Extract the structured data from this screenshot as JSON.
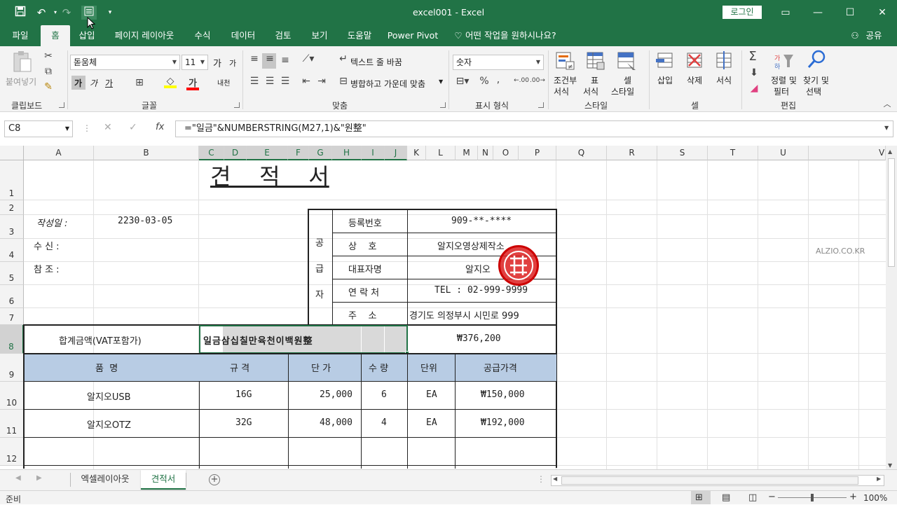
{
  "window": {
    "title": "excel001  -  Excel",
    "login_label": "로그인"
  },
  "menu": [
    "파일",
    "홈",
    "삽입",
    "페이지 레이아웃",
    "수식",
    "데이터",
    "검토",
    "보기",
    "도움말",
    "Power Pivot"
  ],
  "tellme": "어떤 작업을 원하시나요?",
  "share": "공유",
  "ribbon": {
    "clipboard": {
      "label": "클립보드",
      "paste": "붙여넣기"
    },
    "font": {
      "label": "글꼴",
      "name": "돋움체",
      "size": "11",
      "bold": "가",
      "italic": "가",
      "underline": "가",
      "grow": "가",
      "shrink": "가",
      "phonetic": "내천"
    },
    "align": {
      "label": "맞춤",
      "wrap": "텍스트 줄 바꿈",
      "merge": "병합하고 가운데 맞춤"
    },
    "number": {
      "label": "표시 형식",
      "format": "숫자"
    },
    "styles": {
      "label": "스타일",
      "cond": "조건부",
      "cond2": "서식",
      "table": "표",
      "table2": "서식",
      "cell": "셀",
      "cell2": "스타일"
    },
    "cells": {
      "label": "셀",
      "insert": "삽입",
      "delete": "삭제",
      "format": "서식"
    },
    "edit": {
      "label": "편집",
      "sort": "정렬 및",
      "sort2": "필터",
      "find": "찾기 및",
      "find2": "선택"
    }
  },
  "namebox": "C8",
  "formula": "=\"일금\"&NUMBERSTRING(M27,1)&\"원整\"",
  "columns": [
    "A",
    "B",
    "C",
    "D",
    "E",
    "F",
    "G",
    "H",
    "I",
    "J",
    "K",
    "L",
    "M",
    "N",
    "O",
    "P",
    "Q",
    "R",
    "S",
    "T",
    "U",
    "V"
  ],
  "rows": [
    "1",
    "2",
    "3",
    "4",
    "5",
    "6",
    "7",
    "8",
    "9",
    "10",
    "11",
    "12"
  ],
  "sheet": {
    "title": "견    적    서",
    "date_label": "작성일  :",
    "date_value": "2230-03-05",
    "to_label": "수  신  :",
    "ref_label": "참  조  :",
    "supplier": [
      "공",
      "급",
      "자"
    ],
    "info_labels": [
      "등록번호",
      "상    호",
      "대표자명",
      "연 락 처",
      "주    소"
    ],
    "info_values": [
      "909-**-****",
      "알지오영상제작소",
      "알지오",
      "TEL : 02-999-9999",
      "경기도 의정부시 시민로 999"
    ],
    "total_label": "합계금액(VAT포함가)",
    "total_korean": "일금삼십칠만육천이백원整",
    "total_value": "₩376,200",
    "headers": [
      "품  명",
      "규 격",
      "단 가",
      "수 량",
      "단위",
      "공급가격"
    ],
    "items": [
      {
        "name": "알지오USB",
        "spec": "16G",
        "price": "25,000",
        "qty": "6",
        "unit": "EA",
        "amount": "₩150,000"
      },
      {
        "name": "알지오OTZ",
        "spec": "32G",
        "price": "48,000",
        "qty": "4",
        "unit": "EA",
        "amount": "₩192,000"
      }
    ],
    "watermark": "ALZIO.CO.KR",
    "stamp": "알지오인"
  },
  "tabs": [
    "엑셀레이아웃",
    "견적서"
  ],
  "status": {
    "ready": "준비",
    "zoom": "100%"
  }
}
